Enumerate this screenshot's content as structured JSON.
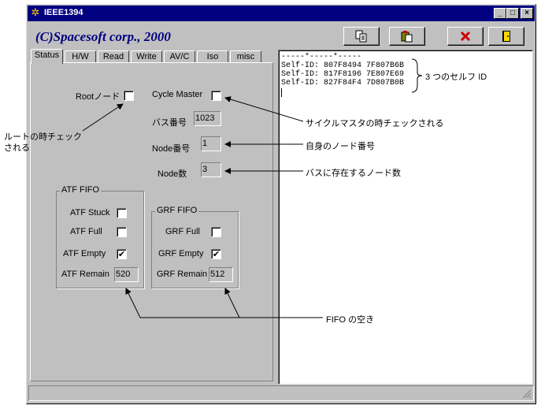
{
  "window": {
    "title": "IEEE1394",
    "minimize": "_",
    "maximize": "□",
    "close": "×"
  },
  "header": {
    "brand": "(C)Spacesoft corp., 2000"
  },
  "tabs": [
    {
      "label": "Status"
    },
    {
      "label": "H/W"
    },
    {
      "label": "Read"
    },
    {
      "label": "Write"
    },
    {
      "label": "AV/C"
    },
    {
      "label": "Iso"
    },
    {
      "label": "misc"
    }
  ],
  "status_tab": {
    "root_label": "Rootノード",
    "root_checked": false,
    "cycle_master_label": "Cycle Master",
    "cycle_master_checked": false,
    "bus_number_label": "バス番号",
    "bus_number_value": "1023",
    "node_number_label": "Node番号",
    "node_number_value": "1",
    "node_count_label": "Node数",
    "node_count_value": "3",
    "atf": {
      "title": "ATF FIFO",
      "stuck_label": "ATF Stuck",
      "stuck_checked": false,
      "full_label": "ATF Full",
      "full_checked": false,
      "empty_label": "ATF Empty",
      "empty_checked": true,
      "remain_label": "ATF Remain",
      "remain_value": "520"
    },
    "grf": {
      "title": "GRF FIFO",
      "full_label": "GRF Full",
      "full_checked": false,
      "empty_label": "GRF Empty",
      "empty_checked": true,
      "remain_label": "GRF Remain",
      "remain_value": "512"
    }
  },
  "log": {
    "lines": [
      "-----*-----*-----",
      "Self-ID: 807F8494 7F807B6B",
      "Self-ID: 817F8196 7E807E69",
      "Self-ID: 827F84F4 7D807B0B"
    ]
  },
  "annotations": {
    "self_ids": "3 つのセルフ ID",
    "root_line1": "ルートの時チェック",
    "root_line2": "される",
    "cycle_master": "サイクルマスタの時チェックされる",
    "node_number": "自身のノード番号",
    "node_count": "バスに存在するノード数",
    "fifo": "FIFO の空き"
  },
  "icons": {
    "toolbar": [
      "copy-icon",
      "paste-icon",
      "delete-x-icon",
      "exit-door-icon"
    ],
    "colors": {
      "title_bar": "#000080",
      "brand": "#000080",
      "delete": "#cc0000",
      "exit": "#ffd700"
    }
  }
}
